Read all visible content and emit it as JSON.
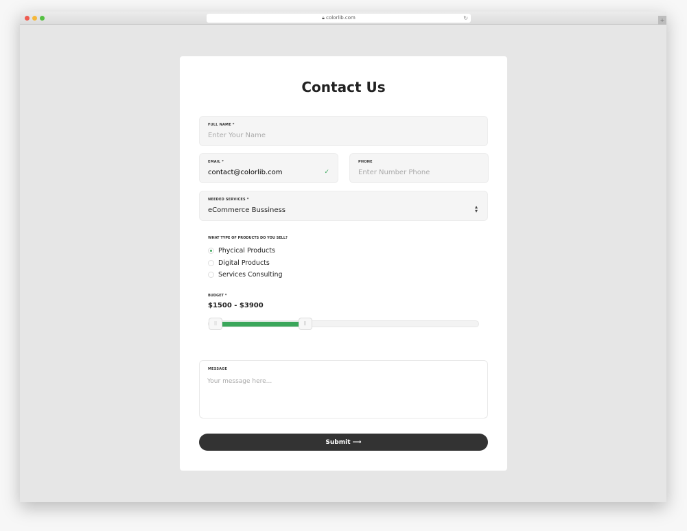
{
  "browser": {
    "url": "colorlib.com"
  },
  "form": {
    "title": "Contact Us",
    "full_name": {
      "label": "FULL NAME *",
      "placeholder": "Enter Your Name"
    },
    "email": {
      "label": "EMAIL *",
      "value": "contact@colorlib.com"
    },
    "phone": {
      "label": "PHONE",
      "placeholder": "Enter Number Phone"
    },
    "services": {
      "label": "NEEDED SERVICES *",
      "value": "eCommerce Bussiness"
    },
    "products": {
      "label": "WHAT TYPE OF PRODUCTS DO YOU SELL?",
      "options": [
        "Phycical Products",
        "Digital Products",
        "Services Consulting"
      ],
      "selected": "Phycical Products"
    },
    "budget": {
      "label": "BUDGET *",
      "value": "$1500 - $3900",
      "slider_low_fraction": 0.0,
      "slider_high_fraction": 0.35
    },
    "message": {
      "label": "MESSAGE",
      "placeholder": "Your message here..."
    },
    "submit": "Submit ⟶"
  },
  "colors": {
    "accent": "#3aa65a",
    "button": "#333333"
  }
}
